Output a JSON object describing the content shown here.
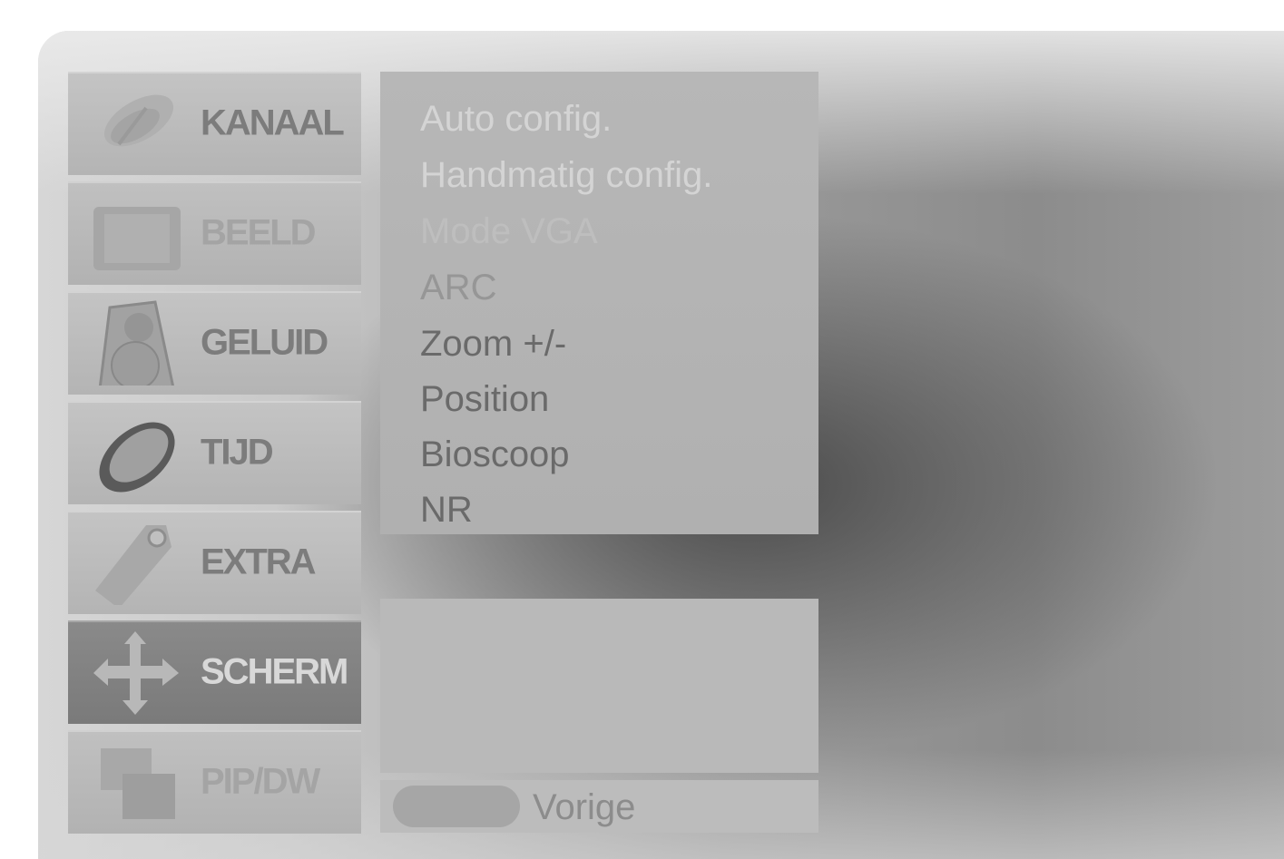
{
  "menu": {
    "categories": [
      {
        "label": "KANAAL",
        "icon": "satellite-dish-icon",
        "state": "normal"
      },
      {
        "label": "BEELD",
        "icon": "picture-frame-icon",
        "state": "dim"
      },
      {
        "label": "GELUID",
        "icon": "speaker-icon",
        "state": "normal"
      },
      {
        "label": "TIJD",
        "icon": "clock-ring-icon",
        "state": "normal"
      },
      {
        "label": "EXTRA",
        "icon": "tag-icon",
        "state": "normal"
      },
      {
        "label": "SCHERM",
        "icon": "move-arrows-icon",
        "state": "selected"
      },
      {
        "label": "PIP/DW",
        "icon": "pip-windows-icon",
        "state": "dim"
      }
    ]
  },
  "submenu": {
    "items": [
      {
        "label": "Auto config.",
        "state": "dim"
      },
      {
        "label": "Handmatig config.",
        "state": "dim"
      },
      {
        "label": "Mode VGA",
        "state": "faint"
      },
      {
        "label": "ARC",
        "state": "mid"
      },
      {
        "label": "Zoom +/-",
        "state": "normal"
      },
      {
        "label": "Position",
        "state": "normal"
      },
      {
        "label": "Bioscoop",
        "state": "normal"
      },
      {
        "label": "NR",
        "state": "normal"
      }
    ]
  },
  "footer": {
    "hint": "Vorige"
  },
  "colors": {
    "panel": "#b7b7b7",
    "selected_category": "#7f7f7f",
    "text_dark": "#6a6a6a"
  }
}
